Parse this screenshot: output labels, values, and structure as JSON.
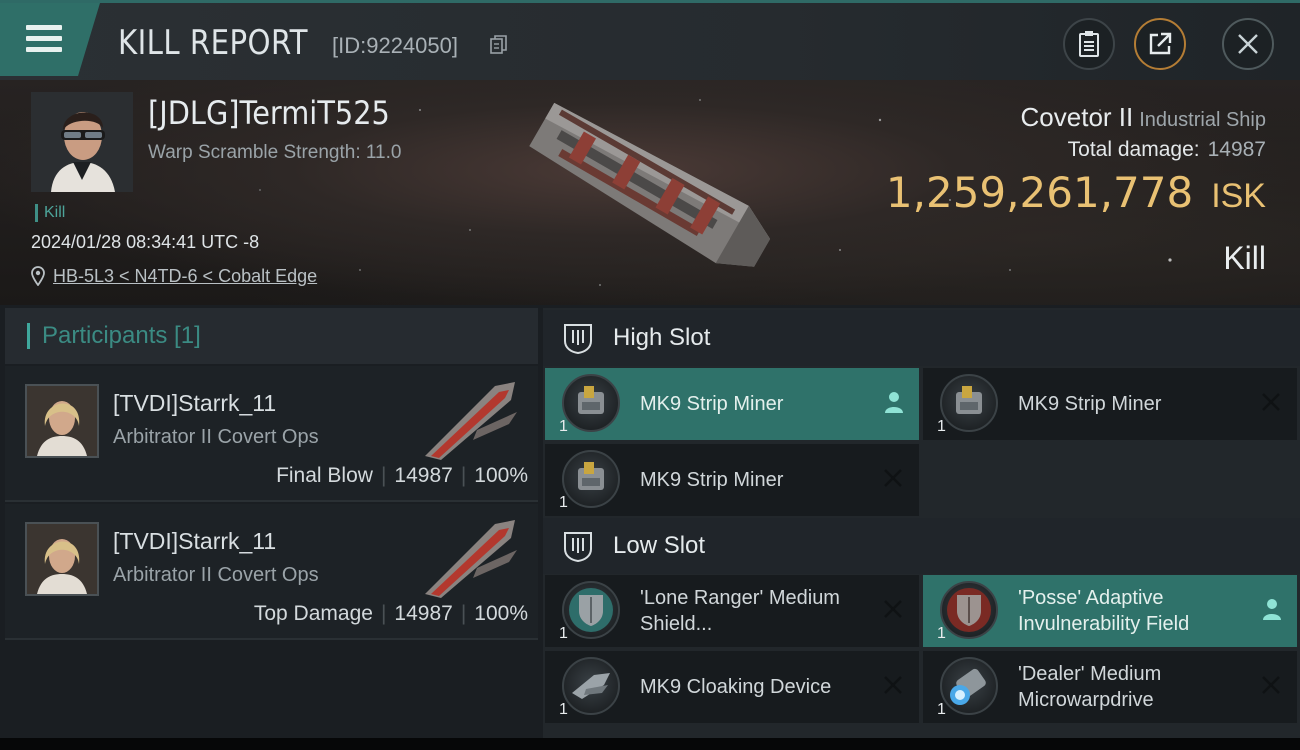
{
  "header": {
    "title": "KILL REPORT",
    "report_id": "[ID:9224050]",
    "icons": [
      "menu-icon",
      "copy-icon",
      "clipboard-icon",
      "share-icon",
      "close-icon"
    ]
  },
  "victim": {
    "name": "[JDLG]TermiT525",
    "warp_scramble": "Warp Scramble Strength: 11.0",
    "tag": "Kill",
    "datetime": "2024/01/28 08:34:41 UTC -8",
    "location": "HB-5L3 < N4TD-6 < Cobalt Edge",
    "ship": "Covetor II",
    "ship_class": "Industrial Ship",
    "total_damage_label": "Total damage:",
    "total_damage_value": "14987",
    "isk_value": "1,259,261,778",
    "isk_unit": "ISK",
    "result": "Kill"
  },
  "participants": {
    "header": "Participants [1]",
    "items": [
      {
        "name": "[TVDI]Starrk_11",
        "ship": "Arbitrator II Covert Ops",
        "role": "Final Blow",
        "damage": "14987",
        "percent": "100%"
      },
      {
        "name": "[TVDI]Starrk_11",
        "ship": "Arbitrator II Covert Ops",
        "role": "Top Damage",
        "damage": "14987",
        "percent": "100%"
      }
    ]
  },
  "slots": {
    "high": {
      "label": "High Slot",
      "modules": [
        {
          "name": "MK9 Strip Miner",
          "qty": "1",
          "status": "dropped"
        },
        {
          "name": "MK9 Strip Miner",
          "qty": "1",
          "status": "destroyed"
        },
        {
          "name": "MK9 Strip Miner",
          "qty": "1",
          "status": "destroyed"
        }
      ]
    },
    "low": {
      "label": "Low Slot",
      "modules": [
        {
          "name": "'Lone Ranger' Medium Shield...",
          "qty": "1",
          "status": "destroyed"
        },
        {
          "name": "'Posse' Adaptive Invulnerability Field",
          "qty": "1",
          "status": "dropped"
        },
        {
          "name": "MK9 Cloaking Device",
          "qty": "1",
          "status": "destroyed"
        },
        {
          "name": "'Dealer' Medium Microwarpdrive",
          "qty": "1",
          "status": "destroyed"
        }
      ]
    }
  },
  "colors": {
    "accent_teal": "#2f726a",
    "isk_gold": "#e9c173",
    "panel_dark": "#171b1e"
  }
}
